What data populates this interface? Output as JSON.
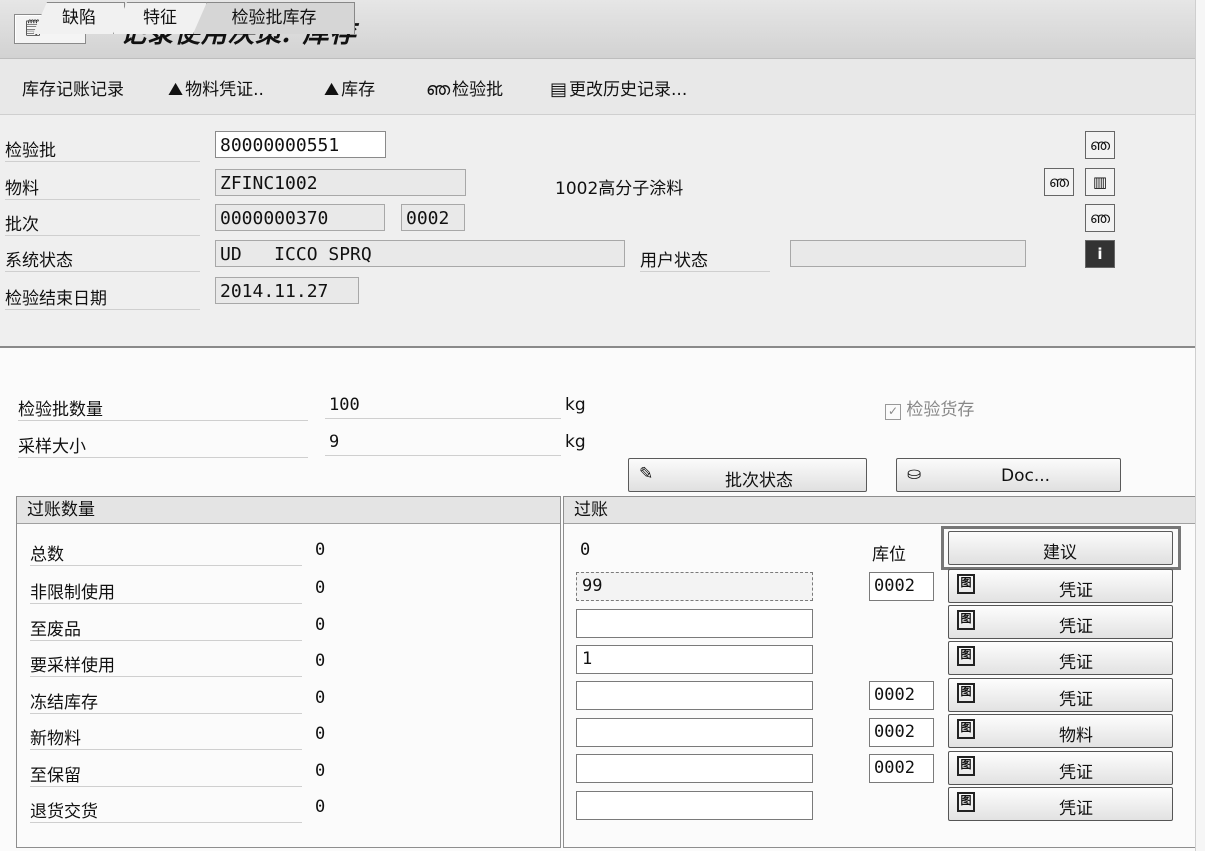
{
  "window": {
    "title": "记录使用决策: 库存"
  },
  "toolbar": {
    "items": [
      "库存记账记录",
      "物料凭证..",
      "库存",
      "检验批",
      "更改历史记录..."
    ]
  },
  "header": {
    "inspection_lot": {
      "label": "检验批",
      "value": "80000000551"
    },
    "material": {
      "label": "物料",
      "value": "ZFINC1002",
      "description": "1002高分子涂料"
    },
    "batch": {
      "label": "批次",
      "value": "0000000370",
      "plant": "0002"
    },
    "system_status": {
      "label": "系统状态",
      "value": "UD   ICCO SPRQ"
    },
    "user_status": {
      "label": "用户状态",
      "value": ""
    },
    "inspection_end_date": {
      "label": "检验结束日期",
      "value": "2014.11.27"
    }
  },
  "tabs": [
    "缺陷",
    "特征",
    "检验批库存"
  ],
  "lot_stock": {
    "lot_quantity": {
      "label": "检验批数量",
      "value": "100",
      "unit": "kg"
    },
    "sample_size": {
      "label": "采样大小",
      "value": "9",
      "unit": "kg"
    },
    "inspection_stock_checkbox": {
      "label": "检验货存",
      "checked": true
    },
    "batch_status_button": "批次状态",
    "doc_button": "Doc..."
  },
  "posted_quantities": {
    "title": "过账数量",
    "rows": [
      {
        "label": "总数",
        "value": "0"
      },
      {
        "label": "非限制使用",
        "value": "0"
      },
      {
        "label": "至废品",
        "value": "0"
      },
      {
        "label": "要采样使用",
        "value": "0"
      },
      {
        "label": "冻结库存",
        "value": "0"
      },
      {
        "label": "新物料",
        "value": "0"
      },
      {
        "label": "至保留",
        "value": "0"
      },
      {
        "label": "退货交货",
        "value": "0"
      }
    ]
  },
  "posting": {
    "title": "过账",
    "total": "0",
    "storage_location_label": "库位",
    "proposal_button": "建议",
    "rows": [
      {
        "qty": "99",
        "sloc": "0002",
        "button": "凭证"
      },
      {
        "qty": "",
        "sloc": "",
        "button": "凭证"
      },
      {
        "qty": "1",
        "sloc": "",
        "button": "凭证"
      },
      {
        "qty": "",
        "sloc": "0002",
        "button": "凭证"
      },
      {
        "qty": "",
        "sloc": "0002",
        "button": "物料"
      },
      {
        "qty": "",
        "sloc": "0002",
        "button": "凭证"
      },
      {
        "qty": "",
        "sloc": "",
        "button": "凭证"
      }
    ]
  }
}
